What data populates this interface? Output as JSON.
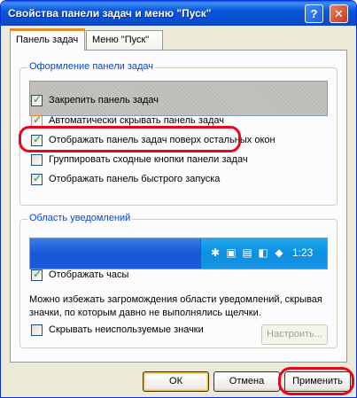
{
  "window": {
    "title": "Свойства панели задач и меню \"Пуск\"",
    "help_label": "?",
    "close_label": "✕"
  },
  "tabs": [
    {
      "label": "Панель задач",
      "active": true
    },
    {
      "label": "Меню \"Пуск\"",
      "active": false
    }
  ],
  "taskbar_group": {
    "legend": "Оформление панели задач",
    "options": [
      {
        "label": "Закрепить панель задач",
        "checked": true
      },
      {
        "label": "Автоматически скрывать панель задач",
        "checked": true
      },
      {
        "label": "Отображать панель задач поверх остальных окон",
        "checked": true
      },
      {
        "label": "Группировать сходные кнопки панели задач",
        "checked": false
      },
      {
        "label": "Отображать панель быстрого запуска",
        "checked": true
      }
    ]
  },
  "notification_group": {
    "legend": "Область уведомлений",
    "clock": "1:23",
    "tray_icons": [
      "network-icon",
      "computer-icon",
      "keyboard-icon",
      "volume-icon",
      "shield-icon"
    ],
    "show_clock": {
      "label": "Отображать часы",
      "checked": true
    },
    "description": "Можно избежать загромождения области уведомлений, скрывая значки, по которым давно не выполнялись щелчки.",
    "hide_inactive": {
      "label": "Скрывать неиспользуемые значки",
      "checked": false
    },
    "configure_label": "Настроить..."
  },
  "footer": {
    "ok_label": "ОК",
    "cancel_label": "Отмена",
    "apply_label": "Применить"
  },
  "colors": {
    "highlight": "#e4081e",
    "title_bar": "#0855dd",
    "group_legend": "#0046d5"
  }
}
